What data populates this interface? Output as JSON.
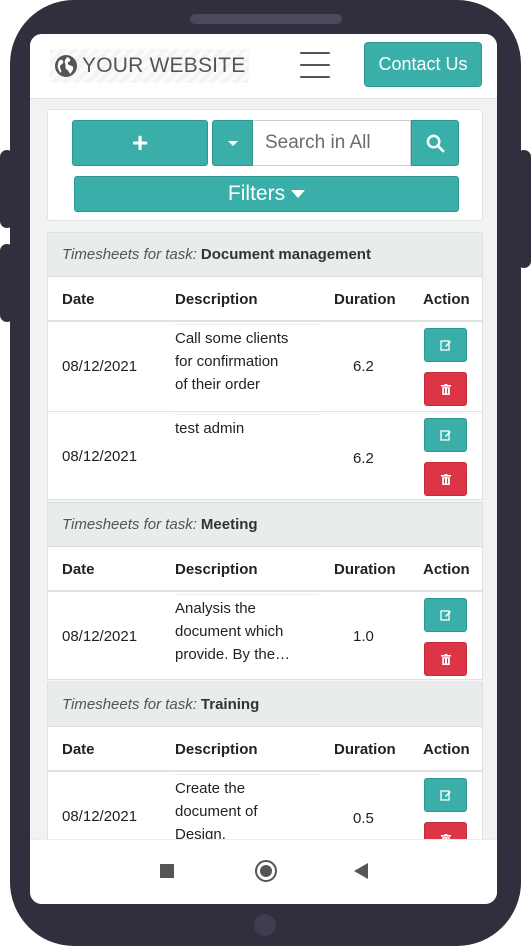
{
  "header": {
    "logo_text": "YOUR WEBSITE",
    "contact_label": "Contact Us"
  },
  "toolbar": {
    "add_label": "+",
    "search_placeholder": "Search in All",
    "filters_label": "Filters"
  },
  "columns": {
    "date": "Date",
    "description": "Description",
    "duration": "Duration",
    "action": "Action"
  },
  "group_prefix": "Timesheets for task:",
  "groups": [
    {
      "task": "Document management",
      "rows": [
        {
          "date": "08/12/2021",
          "desc_lines": [
            "Call some clients",
            "for confirmation",
            "of their order"
          ],
          "duration": "6.2"
        },
        {
          "date": "08/12/2021",
          "desc_lines": [
            "test admin"
          ],
          "duration": "6.2"
        }
      ]
    },
    {
      "task": "Meeting",
      "rows": [
        {
          "date": "08/12/2021",
          "desc_lines": [
            "Analysis the",
            "document which",
            "provide. By the…"
          ],
          "duration": "1.0"
        }
      ]
    },
    {
      "task": "Training",
      "rows": [
        {
          "date": "08/12/2021",
          "desc_lines": [
            "Create the",
            "document of",
            "Design."
          ],
          "duration": "0.5"
        }
      ]
    }
  ],
  "colors": {
    "primary": "#3aafa9",
    "danger": "#dc3545",
    "phone_frame": "#2f2f3e"
  }
}
